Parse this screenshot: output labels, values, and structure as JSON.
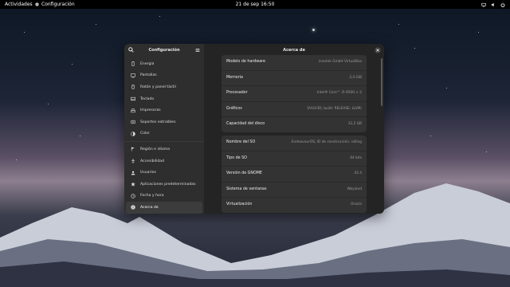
{
  "topbar": {
    "activities": "Actividades",
    "app_name": "Configuración",
    "clock": "21 de sep  16:50"
  },
  "sidebar": {
    "title": "Configuración",
    "items": [
      {
        "label": "Energía",
        "icon": "battery-icon"
      },
      {
        "label": "Pantallas",
        "icon": "display-icon"
      },
      {
        "label": "Ratón y panel táctil",
        "icon": "mouse-icon"
      },
      {
        "label": "Teclado",
        "icon": "keyboard-icon"
      },
      {
        "label": "Impresoras",
        "icon": "printer-icon"
      },
      {
        "label": "Soportes extraíbles",
        "icon": "media-icon"
      },
      {
        "label": "Color",
        "icon": "color-icon"
      },
      {
        "label": "Región e idioma",
        "icon": "flag-icon"
      },
      {
        "label": "Accesibilidad",
        "icon": "accessibility-icon"
      },
      {
        "label": "Usuarios",
        "icon": "users-icon"
      },
      {
        "label": "Aplicaciones predeterminadas",
        "icon": "star-icon"
      },
      {
        "label": "Fecha y hora",
        "icon": "clock-icon"
      },
      {
        "label": "Acerca de",
        "icon": "info-icon"
      }
    ]
  },
  "main": {
    "title": "Acerca de",
    "hardware": [
      {
        "label": "Modelo de hardware",
        "value": "innotek GmbH VirtualBox"
      },
      {
        "label": "Memoria",
        "value": "2,4 GiB"
      },
      {
        "label": "Procesador",
        "value": "Intel® Core™ i5-9500 × 2"
      },
      {
        "label": "Gráficos",
        "value": "SVGA3D; build: RELEASE; LLVM;"
      },
      {
        "label": "Capacidad del disco",
        "value": "32,2 GB"
      }
    ],
    "software": [
      {
        "label": "Nombre del SO",
        "value": "EndeavourOS; ID de construcción: rolling"
      },
      {
        "label": "Tipo de SO",
        "value": "64 bits"
      },
      {
        "label": "Versión de GNOME",
        "value": "42.4"
      },
      {
        "label": "Sistema de ventanas",
        "value": "Wayland"
      },
      {
        "label": "Virtualización",
        "value": "Oracle"
      }
    ]
  }
}
